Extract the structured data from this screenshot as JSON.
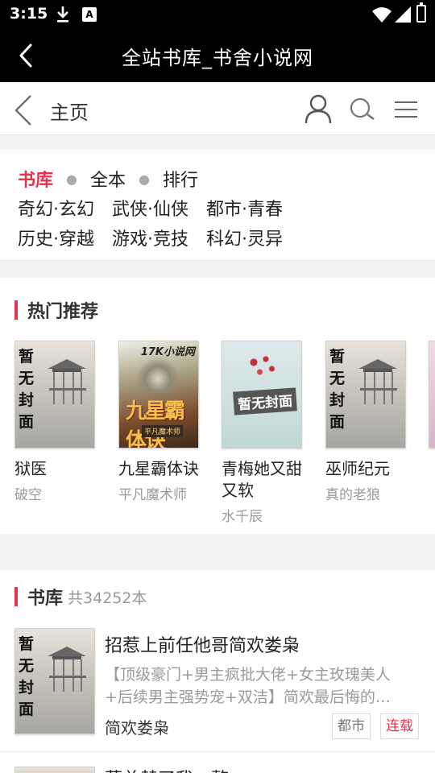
{
  "status_bar": {
    "time": "3:15",
    "icons": [
      "download-icon",
      "a-icon",
      "wifi-icon",
      "signal-icon",
      "battery-icon"
    ],
    "a_icon_label": "A"
  },
  "title_bar": {
    "title": "全站书库_书舍小说网",
    "back_icon": "chevron-left-icon"
  },
  "nav_bar": {
    "home_label": "主页",
    "icons": [
      "chevron-left-icon",
      "user-icon",
      "search-icon",
      "menu-icon"
    ]
  },
  "categories": {
    "row1": {
      "active": "书库",
      "items": [
        "全本",
        "排行"
      ]
    },
    "row2": [
      "奇幻·玄幻",
      "武侠·仙侠",
      "都市·青春"
    ],
    "row3": [
      "历史·穿越",
      "游戏·竞技",
      "科幻·灵异"
    ]
  },
  "hot": {
    "heading": "热门推荐",
    "books": [
      {
        "title": "狱医",
        "author": "破空",
        "cover": "default",
        "cover_text": [
          "暂",
          "无",
          "封",
          "面"
        ]
      },
      {
        "title": "九星霸体诀",
        "author": "平凡魔术师",
        "cover": "17k",
        "cover_logo": "17K小说网",
        "cover_title": "九星霸体诀",
        "cover_tag": "平凡魔术师"
      },
      {
        "title": "青梅她又甜又软",
        "author": "水千辰",
        "cover": "plain",
        "cover_text": "暂无封面"
      },
      {
        "title": "巫师纪元",
        "author": "真的老狼",
        "cover": "default",
        "cover_text": [
          "暂",
          "无",
          "封",
          "面"
        ]
      }
    ]
  },
  "library": {
    "heading": "书库",
    "count": "共34252本",
    "items": [
      {
        "title": "招惹上前任他哥简欢娄枭",
        "desc": "【顶级豪门+男主疯批大佬+女主玫瑰美人+后续男主强势宠+双洁】简欢最后悔的…",
        "author": "简欢娄枭",
        "tag": "都市",
        "status": "连载",
        "cover_text": [
          "暂",
          "无",
          "封",
          "面"
        ]
      },
      {
        "title": "慕总替了我一整"
      }
    ]
  },
  "colors": {
    "accent": "#e5334c",
    "header_bg": "#000000"
  }
}
